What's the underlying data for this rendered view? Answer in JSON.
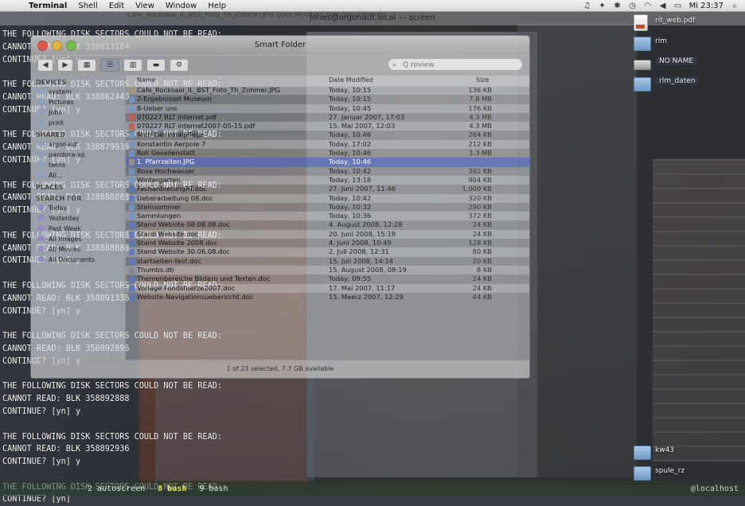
{
  "menubar": {
    "apple": "",
    "app_name": "Terminal",
    "items": [
      "Shell",
      "Edit",
      "View",
      "Window",
      "Help"
    ],
    "status": {
      "icons": [
        "music-icon",
        "dropbox-icon",
        "bluetooth-icon",
        "time-machine-icon",
        "wifi-icon",
        "volume-icon",
        "battery-icon"
      ],
      "clock": "Mi 23:37"
    }
  },
  "terminal": {
    "title": "jonas@argonaut.local — screen",
    "lines": [
      "THE FOLLOWING DISK SECTORS COULD NOT BE READ:",
      "CANNOT READ: BLK 338813184",
      "CONTINUE? [yn] y",
      "",
      "THE FOLLOWING DISK SECTORS COULD NOT BE READ:",
      "CANNOT READ: BLK 338862440",
      "CONTINUE? [yn] y",
      "",
      "THE FOLLOWING DISK SECTORS COULD NOT BE READ:",
      "CANNOT READ: BLK 338879936",
      "CONTINUE? [yn] y",
      "",
      "THE FOLLOWING DISK SECTORS COULD NOT BE READ:",
      "CANNOT READ: BLK 338888888",
      "CONTINUE? [yn] y",
      "",
      "THE FOLLOWING DISK SECTORS COULD NOT BE READ:",
      "CANNOT READ: BLK 338888888",
      "CONTINUE? [yn] y",
      "",
      "THE FOLLOWING DISK SECTORS COULD NOT BE READ:",
      "CANNOT READ: BLK 358891336",
      "CONTINUE? [yn] y",
      "",
      "THE FOLLOWING DISK SECTORS COULD NOT BE READ:",
      "CANNOT READ: BLK 358892896",
      "CONTINUE? [yn] y",
      "",
      "THE FOLLOWING DISK SECTORS COULD NOT BE READ:",
      "CANNOT READ: BLK 358892888",
      "CONTINUE? [yn] y",
      "",
      "THE FOLLOWING DISK SECTORS COULD NOT BE READ:",
      "CANNOT READ: BLK 358892936",
      "CONTINUE? [yn] y",
      "",
      "THE FOLLOWING DISK SECTORS COULD NOT BE READ:",
      "CONTINUE? [yn]"
    ],
    "tabs": [
      "2 autoscreen",
      "8 bash",
      "9 bash"
    ],
    "active_tab": "8 bash",
    "host": "@localhost"
  },
  "finder": {
    "title": "Smart Folder",
    "search_placeholder": "Q review",
    "sidebar": [
      {
        "head": "DEVICES"
      },
      {
        "item": "system"
      },
      {
        "item": "Pictures"
      },
      {
        "item": "Jobs"
      },
      {
        "item": "print"
      },
      {
        "head": "SHARED"
      },
      {
        "item": "argonaut"
      },
      {
        "item": "pandora-xp"
      },
      {
        "item": "twins"
      },
      {
        "item": "All..."
      },
      {
        "head": "PLACES"
      },
      {
        "head": "SEARCH FOR"
      },
      {
        "item": "Today",
        "smart": true
      },
      {
        "item": "Yesterday",
        "smart": true
      },
      {
        "item": "Past Week",
        "smart": true
      },
      {
        "item": "All Images",
        "smart": true
      },
      {
        "item": "All Movies",
        "smart": true
      },
      {
        "item": "All Documents",
        "smart": true
      }
    ],
    "columns": {
      "name": "Name",
      "date": "Date Modified",
      "size": "Size"
    },
    "rows": [
      {
        "name": "Cafe_Rocksaal_IL_BST_Foto_Th_Zohmer.JPG",
        "date": "Today, 10:15",
        "size": "136 KB",
        "type": "jpg"
      },
      {
        "name": "2-Ergebnisort Museum",
        "date": "Today, 10:15",
        "size": "7.8 MB",
        "type": "folder"
      },
      {
        "name": "8-Ueber uns",
        "date": "Today, 10:45",
        "size": "176 KB",
        "type": "folder"
      },
      {
        "name": "070227 RLT internet.pdf",
        "date": "27. Januar 2007, 17:03",
        "size": "4.3 MB",
        "type": "pdf"
      },
      {
        "name": "070227 RLT internet2007-05-15.pdf",
        "date": "15. Mai 2007, 12:03",
        "size": "4.3 MB",
        "type": "pdf"
      },
      {
        "name": "Arch Denkmalpflege",
        "date": "Today, 10:46",
        "size": "264 KB",
        "type": "folder"
      },
      {
        "name": "Konstantin Aerpole 7",
        "date": "Today, 17:02",
        "size": "212 KB",
        "type": "folder"
      },
      {
        "name": "Roll Gesellenstatt",
        "date": "Today, 10:46",
        "size": "1.3 MB",
        "type": "folder"
      },
      {
        "name": "1. Pfarrzeiten.JPG",
        "date": "Today, 10:46",
        "size": "",
        "type": "jpg",
        "selected": true
      },
      {
        "name": "Rosa Hochwasser",
        "date": "Today, 10:42",
        "size": "392 KB",
        "type": "folder"
      },
      {
        "name": "Wintergarten",
        "date": "Today, 13:18",
        "size": "904 KB",
        "type": "folder"
      },
      {
        "name": "FachanbietungRT.doc",
        "date": "27. Juni 2007, 11:46",
        "size": "1,000 KB",
        "type": "doc"
      },
      {
        "name": "Ueberarbeitung 08.doc",
        "date": "Today, 10:42",
        "size": "320 KB",
        "type": "doc"
      },
      {
        "name": "Steinsommer",
        "date": "Today, 10:32",
        "size": "290 KB",
        "type": "folder"
      },
      {
        "name": "Sammlungen",
        "date": "Today, 10:36",
        "size": "372 KB",
        "type": "folder"
      },
      {
        "name": "Stand Website 08.08.08.doc",
        "date": "4. August 2008, 12:28",
        "size": "24 KB",
        "type": "doc"
      },
      {
        "name": "Stand Website.doc",
        "date": "20. Juni 2008, 15:18",
        "size": "24 KB",
        "type": "doc"
      },
      {
        "name": "Stand Website 2008.doc",
        "date": "4. Juni 2008, 10:49",
        "size": "128 KB",
        "type": "doc"
      },
      {
        "name": "Stand Website 30.06.08.doc",
        "date": "2. Juli 2008, 12:31",
        "size": "80 KB",
        "type": "doc"
      },
      {
        "name": "startseiten-test.doc",
        "date": "15. Juli 2008, 14:14",
        "size": "20 KB",
        "type": "doc"
      },
      {
        "name": "Thumbs.db",
        "date": "15. August 2008, 08:19",
        "size": "8 KB",
        "type": "file"
      },
      {
        "name": "Themenbereiche Bildern und Texten.doc",
        "date": "Today, 09:55",
        "size": "24 KB",
        "type": "doc"
      },
      {
        "name": "Vorlage Fondsfuerze2007.doc",
        "date": "17. Mai 2007, 11:17",
        "size": "24 KB",
        "type": "doc"
      },
      {
        "name": "Website-Navigationsuebersicht.doc",
        "date": "15. Maerz 2007, 12:29",
        "size": "44 KB",
        "type": "doc"
      }
    ],
    "status": "1 of 23 selected, 7.7 GB available"
  },
  "ghost_titles": "Cafe_Rocksaal_IL_BST_Foto_Th_Zohmer.JPG    Date Modified    Size    besucherinfo",
  "desktop": {
    "icons": [
      {
        "label": "rit_web.pdf",
        "kind": "file",
        "pill": false
      },
      {
        "label": "rlm",
        "kind": "folder",
        "pill": false
      },
      {
        "label": "NO NAME",
        "kind": "drive",
        "pill": true
      },
      {
        "label": "rlm_daten",
        "kind": "folder",
        "pill": true
      },
      {
        "label": "kw43",
        "kind": "folder",
        "pill": false
      },
      {
        "label": "spule_rz",
        "kind": "folder",
        "pill": false
      }
    ]
  }
}
